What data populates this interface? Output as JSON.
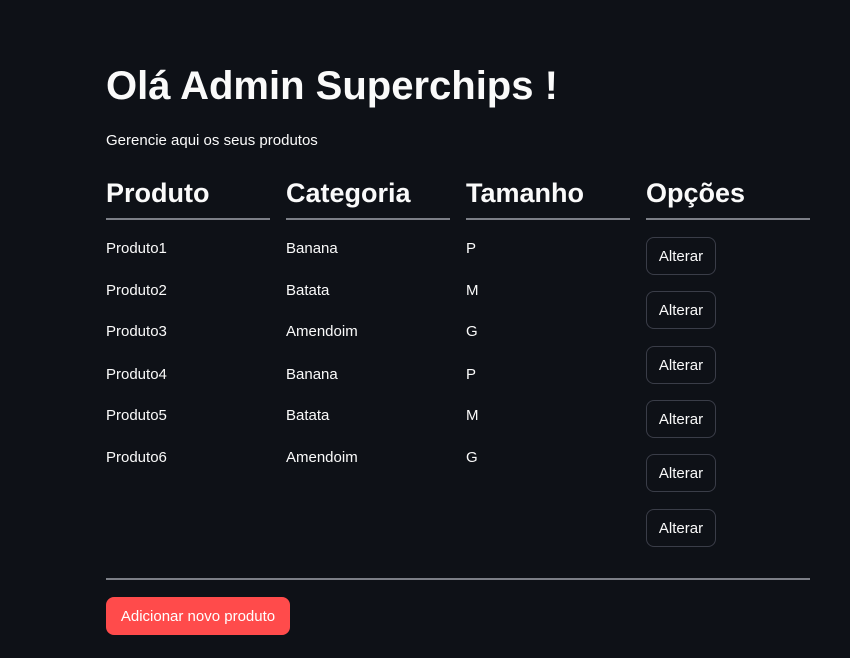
{
  "page": {
    "title": "Olá Admin Superchips !",
    "subtitle": "Gerencie aqui os seus produtos"
  },
  "table": {
    "headers": [
      "Produto",
      "Categoria",
      "Tamanho",
      "Opções"
    ],
    "rows": [
      {
        "produto": "Produto1",
        "categoria": "Banana",
        "tamanho": "P",
        "option_label": "Alterar"
      },
      {
        "produto": "Produto2",
        "categoria": "Batata",
        "tamanho": "M",
        "option_label": "Alterar"
      },
      {
        "produto": "Produto3",
        "categoria": "Amendoim",
        "tamanho": "G",
        "option_label": "Alterar"
      },
      {
        "produto": "Produto4",
        "categoria": "Banana",
        "tamanho": "P",
        "option_label": "Alterar"
      },
      {
        "produto": "Produto5",
        "categoria": "Batata",
        "tamanho": "M",
        "option_label": "Alterar"
      },
      {
        "produto": "Produto6",
        "categoria": "Amendoim",
        "tamanho": "G",
        "option_label": "Alterar"
      }
    ]
  },
  "actions": {
    "add_label": "Adicionar novo produto"
  },
  "colors": {
    "background": "#0e1117",
    "text": "#fafafa",
    "accent": "#ff4b4b",
    "divider": "#7c7f87",
    "button_border": "#3a3d48"
  }
}
